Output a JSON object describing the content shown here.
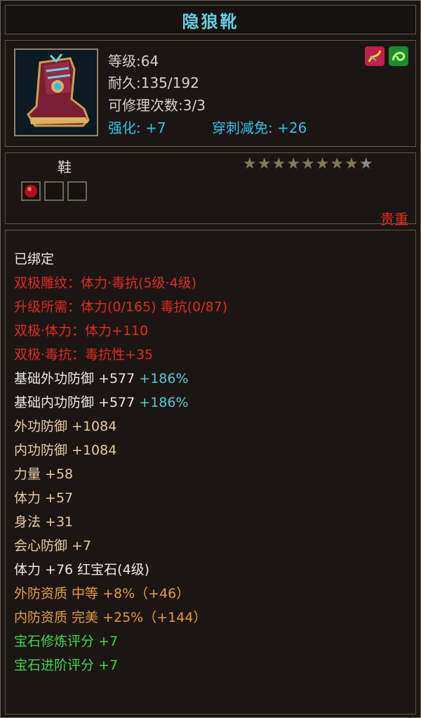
{
  "item": {
    "name": "隐狼靴",
    "level": "等级:64",
    "durability": "耐久:135/192",
    "repair": "可修理次数:3/3",
    "enhance": "强化: +7",
    "pierce_reduce": "穿刺减免: +26",
    "type": "鞋",
    "rarity": "贵重",
    "stars_filled": 8,
    "stars_total": 9
  },
  "attrs": {
    "bound": "已绑定",
    "dual": "双极雕纹：体力·毒抗(5级·4级)",
    "upgrade_need": "升级所需：体力(0/165)  毒抗(0/87)",
    "dual_vit": "双极·体力：体力+110",
    "dual_poison": "双极·毒抗：毒抗性+35",
    "base_ext_def": "基础外功防御 +577",
    "base_ext_def_pct": "+186%",
    "base_int_def": "基础内功防御 +577",
    "base_int_def_pct": "+186%",
    "ext_def": "外功防御 +1084",
    "int_def": "内功防御 +1084",
    "strength": "力量 +58",
    "vitality": "体力 +57",
    "agility": "身法 +31",
    "crit_def": "会心防御 +7",
    "gem_vit": "体力 +76 红宝石(4级)",
    "ext_quality": "外防资质  中等 +8%（+46）",
    "int_quality": "内防资质  完美 +25%（+144）",
    "gem_refine": "宝石修炼评分 +7",
    "gem_advance": "宝石进阶评分 +7"
  },
  "colors": {
    "title": "#66ccdd",
    "red": "#e02a20",
    "tan": "#e7cba0",
    "orange": "#e69a3a",
    "green": "#3fd546",
    "cyan": "#2ec2e8"
  },
  "icons": [
    "boot-item-icon",
    "red-flame-badge-icon",
    "green-swirl-badge-icon",
    "ruby-gem-icon",
    "star-icon"
  ]
}
